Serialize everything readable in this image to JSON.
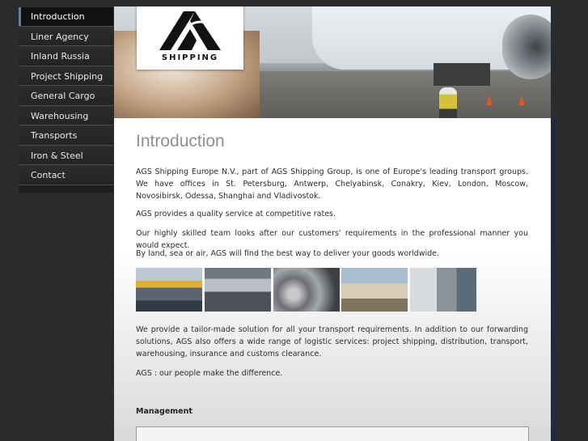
{
  "logo": {
    "text": "SHIPPING"
  },
  "sidebar": {
    "items": [
      {
        "label": "Introduction",
        "active": true
      },
      {
        "label": "Liner Agency"
      },
      {
        "label": "Inland Russia"
      },
      {
        "label": "Project Shipping"
      },
      {
        "label": "General Cargo"
      },
      {
        "label": "Warehousing"
      },
      {
        "label": "Transports"
      },
      {
        "label": "Iron & Steel"
      },
      {
        "label": "Contact"
      }
    ]
  },
  "main": {
    "title": "Introduction",
    "paragraphs": [
      "AGS Shipping Europe N.V., part of AGS Shipping Group, is one of Europe's leading transport groups. We have offices in St. Petersburg, Antwerp, Chelyabinsk, Conakry, Kiev, London, Moscow, Novosibirsk, Odessa, Shanghai and Vladivostok.",
      "AGS provides a quality service at competitive rates.",
      "Our highly skilled team looks after our customers' requirements in the professional manner you would expect.",
      "By land, sea or air, AGS will find the best way to deliver your goods worldwide.",
      "We provide a tailor-made solution for all your transport requirements. In addition to our forwarding solutions, AGS also offers a wide range of logistic services: project shipping, distribution, transport, warehousing, insurance and customs clearance.",
      "AGS : our people make the difference."
    ],
    "gallery": [
      {
        "subject": "port-crane-photo"
      },
      {
        "subject": "warehouse-cargo-photo"
      },
      {
        "subject": "steel-coils-photo"
      },
      {
        "subject": "air-cargo-photo"
      },
      {
        "subject": "container-loading-photo"
      }
    ],
    "management_title": "Management"
  },
  "colors": {
    "background": "#2a2b2d",
    "sidebar": "#1f1f20",
    "active_accent": "#5d7fa9",
    "title_gray": "#8f8f8f",
    "right_bar": "#1c2c44"
  }
}
